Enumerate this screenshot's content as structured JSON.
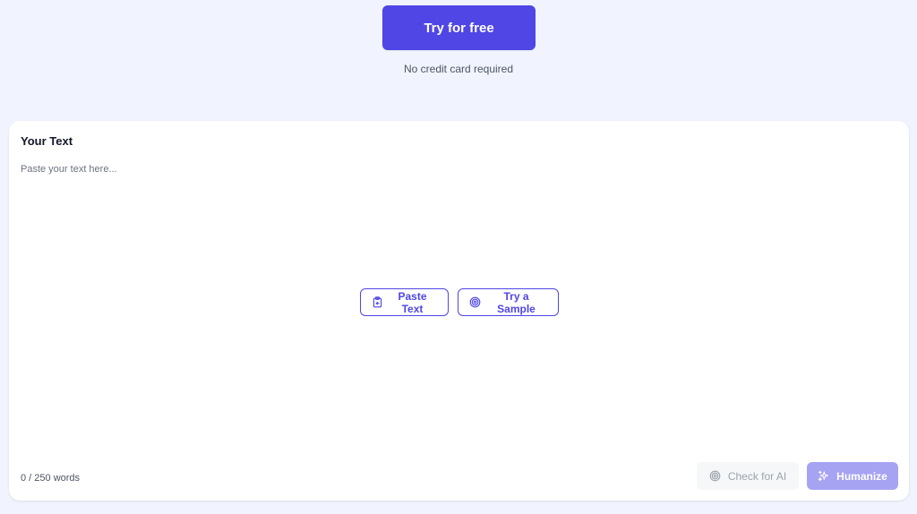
{
  "cta": {
    "try_label": "Try for free",
    "no_card_note": "No credit card required"
  },
  "editor": {
    "title": "Your Text",
    "placeholder": "Paste your text here...",
    "paste_label": "Paste Text",
    "sample_label": "Try a Sample",
    "word_count": "0 / 250 words",
    "check_label": "Check for AI",
    "humanize_label": "Humanize"
  },
  "icons": {
    "paste": "clipboard-icon",
    "sample": "target-icon",
    "check": "target-icon",
    "humanize": "sparkles-icon"
  },
  "colors": {
    "accent": "#4f46e5",
    "accent_disabled": "#a7a3f3",
    "page_background": "#f1f4fe",
    "card_background": "#ffffff"
  }
}
